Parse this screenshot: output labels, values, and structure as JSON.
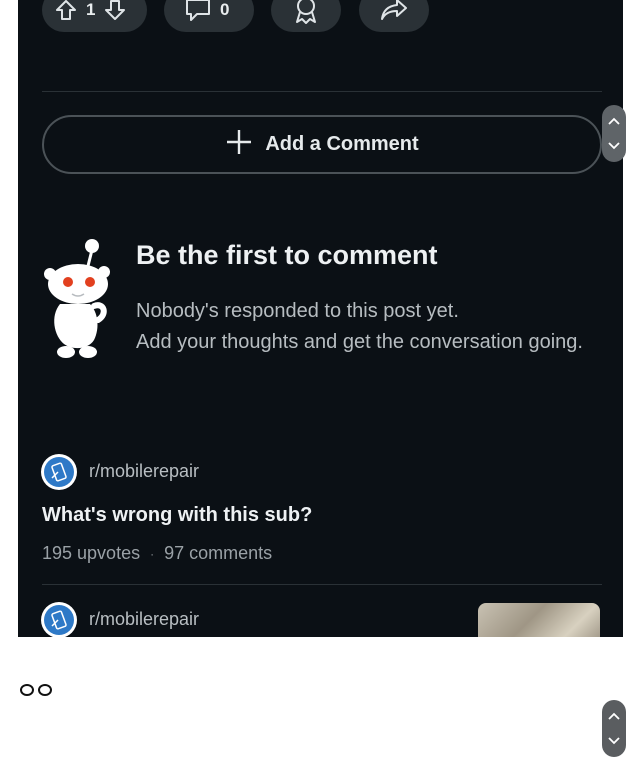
{
  "action_bar": {
    "upvote_count": "1",
    "comment_count": "0"
  },
  "add_comment": {
    "label": "Add a Comment"
  },
  "empty_state": {
    "title": "Be the first to comment",
    "line1": "Nobody's responded to this post yet.",
    "line2": "Add your thoughts and get the conversation going."
  },
  "related_posts": [
    {
      "subreddit": "r/mobilerepair",
      "title": "What's wrong with this sub?",
      "upvotes": "195 upvotes",
      "separator": "·",
      "comments": "97 comments"
    },
    {
      "subreddit": "r/mobilerepair"
    }
  ],
  "colors": {
    "background": "#0b1015",
    "pill": "#2a3136",
    "subreddit_icon": "#2e79c7"
  }
}
